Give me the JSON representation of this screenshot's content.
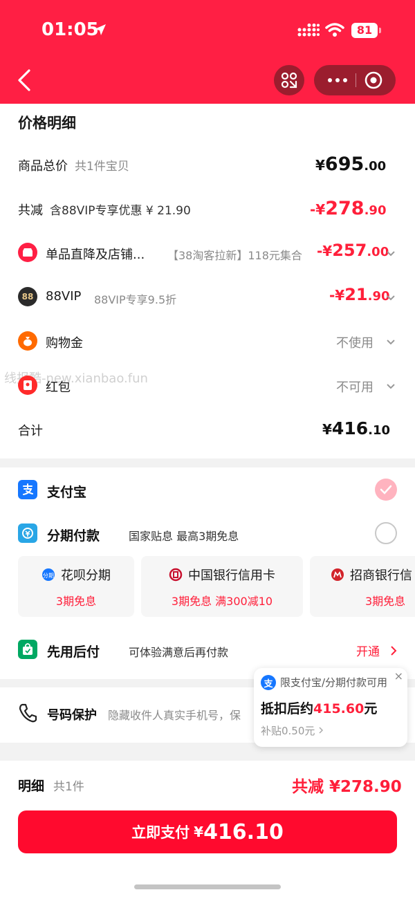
{
  "status_bar": {
    "time": "01:05",
    "battery": "81"
  },
  "price_detail": {
    "title": "价格明细",
    "total_label": "商品总价",
    "total_sub": "共1件宝贝",
    "total_cur": "¥",
    "total_int": "695",
    "total_dec": ".00",
    "discount_label": "共减",
    "discount_sub": "含88VIP专享优惠 ¥ 21.90",
    "discount_cur": "-¥",
    "discount_int": "278",
    "discount_dec": ".90",
    "items": [
      {
        "label": "单品直降及店铺...",
        "note": "【38淘客拉新】118元集合",
        "cur": "-¥",
        "int": "257",
        "dec": ".00",
        "icon": "shop-icon",
        "color": "#ff1f44"
      },
      {
        "label": "88VIP",
        "note": "88VIP专享9.5折",
        "cur": "-¥",
        "int": "21",
        "dec": ".90",
        "icon": "vip88-icon",
        "icon_text": "88",
        "color": "#2b2b2b"
      },
      {
        "label": "购物金",
        "value": "不使用",
        "icon": "money-bag-icon",
        "color": "#ff6a00"
      },
      {
        "label": "红包",
        "value": "不可用",
        "icon": "red-packet-icon",
        "color": "#ff2a2a"
      }
    ],
    "sum_label": "合计",
    "sum_cur": "¥",
    "sum_int": "416",
    "sum_dec": ".10"
  },
  "watermark": "线报酷-new.xianbao.fun",
  "payment": {
    "alipay_label": "支付宝",
    "installment_label": "分期付款",
    "installment_note": "国家贴息 最高3期免息",
    "cards": [
      {
        "title": "花呗分期",
        "sub": "3期免息",
        "icon": "huabei-icon"
      },
      {
        "title": "中国银行信用卡",
        "sub": "3期免息  满300减10",
        "icon": "boc-icon"
      },
      {
        "title": "招商银行信",
        "sub": "3期免息",
        "icon": "cmb-icon"
      }
    ],
    "bnpl_label": "先用后付",
    "bnpl_note": "可体验满意后再付款",
    "bnpl_action": "开通"
  },
  "privacy": {
    "label": "号码保护",
    "note": "隐藏收件人真实手机号，保"
  },
  "popup": {
    "top_text": "限支付宝/分期付款可用",
    "main_prefix": "抵扣后约",
    "main_value": "415.60",
    "main_suffix": "元",
    "sub_text": "补贴0.50元",
    "close": "×",
    "ali_glyph": "支"
  },
  "footer": {
    "detail_label": "明细",
    "detail_count": "共1件",
    "saving_text": "共减 ¥278.90",
    "pay_label": "立即支付",
    "pay_cur": "¥",
    "pay_amount": "416.10"
  },
  "colors": {
    "brand_red": "#ff1f44",
    "price_red": "#ff1f3a",
    "alipay_blue": "#1677ff",
    "bnpl_green": "#00a862"
  }
}
